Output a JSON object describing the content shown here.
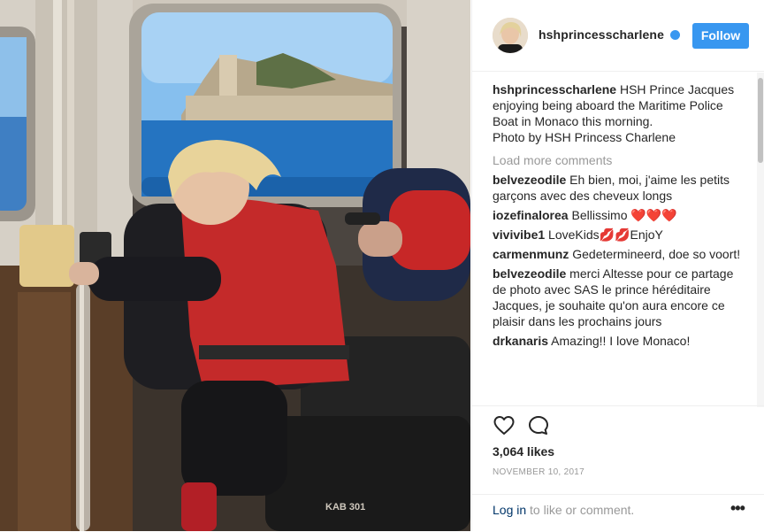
{
  "post": {
    "username": "hshprincesscharlene",
    "follow_label": "Follow",
    "verified_icon": "verified-badge-icon",
    "caption_user": "hshprincesscharlene",
    "caption_text": "HSH Prince Jacques enjoying being aboard the Maritime Police Boat in Monaco this morning.",
    "caption_credit": "Photo by HSH Princess Charlene",
    "load_more": "Load more comments",
    "comments": [
      {
        "user": "belvezeodile",
        "text": "Eh bien, moi, j'aime les petits garçons avec des cheveux longs"
      },
      {
        "user": "iozefinalorea",
        "text": "Bellissimo ❤️❤️❤️"
      },
      {
        "user": "vivivibe1",
        "text": "LoveKids💋💋EnjoY"
      },
      {
        "user": "carmenmunz",
        "text": "Gedetermineerd, doe so voort!"
      },
      {
        "user": "belvezeodile",
        "text": "merci Altesse pour ce partage de photo avec SAS le prince héréditaire Jacques, je souhaite qu'on aura encore ce plaisir dans les prochains jours"
      },
      {
        "user": "drkanaris",
        "text": "Amazing!! I love Monaco!"
      }
    ],
    "likes": "3,064 likes",
    "date": "NOVEMBER 10, 2017",
    "login_link": "Log in",
    "login_rest": " to like or comment.",
    "more_label": "•••",
    "boat_label": "KAB 301"
  },
  "colors": {
    "accent": "#3897f0",
    "text": "#262626",
    "muted": "#999999",
    "link": "#003569"
  }
}
